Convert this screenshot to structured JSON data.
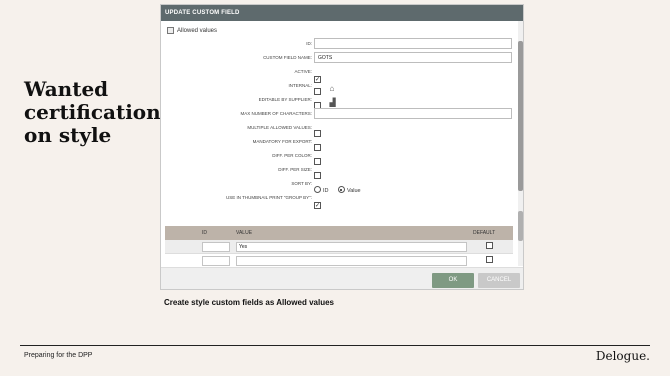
{
  "slide": {
    "headline": "Wanted certifications on style",
    "caption": "Create style custom fields as Allowed values",
    "footer_left": "Preparing for the DPP",
    "brand": "Delogue."
  },
  "dialog": {
    "title": "UPDATE CUSTOM FIELD",
    "allowed_values_label": "Allowed values",
    "fields": {
      "id_label": "ID:",
      "id_value": "",
      "name_label": "CUSTOM FIELD NAME:",
      "name_value": "GOTS",
      "active_label": "ACTIVE:",
      "active_checked": true,
      "internal_label": "INTERNAL:",
      "internal_checked": false,
      "editable_label": "EDITABLE BY SUPPLIER:",
      "editable_checked": false,
      "maxchars_label": "MAX NUMBER OF CHARACTERS:",
      "maxchars_value": "",
      "multiple_label": "MULTIPLE ALLOWED VALUES:",
      "multiple_checked": false,
      "mandatory_label": "MANDATORY FOR EXPORT:",
      "mandatory_checked": false,
      "diffcolor_label": "DIFF. PER COLOR:",
      "diffcolor_checked": false,
      "diffsize_label": "DIFF. PER SIZE:",
      "diffsize_checked": false,
      "sortby_label": "SORT BY:",
      "sortby_options": [
        "ID",
        "Value"
      ],
      "sortby_selected": "Value",
      "thumbnail_label": "USE IN THUMBNAIL PRINT \"GROUP BY\":",
      "thumbnail_checked": true
    },
    "table": {
      "headers": [
        "ID",
        "VALUE",
        "DEFAULT"
      ],
      "rows": [
        {
          "id": "",
          "value": "Yes",
          "default": false
        },
        {
          "id": "",
          "value": "",
          "default": false
        }
      ]
    },
    "buttons": {
      "ok": "OK",
      "cancel": "CANCEL"
    }
  }
}
